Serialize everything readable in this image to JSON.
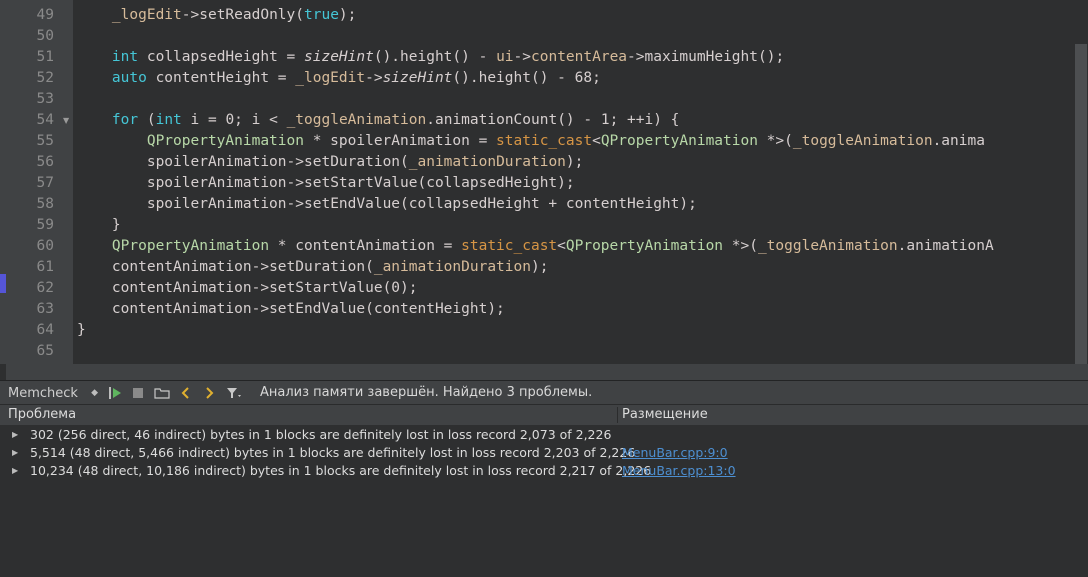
{
  "editor": {
    "lines": [
      {
        "num": "49",
        "code": [
          [
            "    ",
            ""
          ],
          [
            "_logEdit",
            "mem"
          ],
          [
            "->",
            "op"
          ],
          [
            "setReadOnly(",
            "op"
          ],
          [
            "true",
            "kw"
          ],
          [
            ");",
            "op"
          ]
        ]
      },
      {
        "num": "50",
        "code": []
      },
      {
        "num": "51",
        "code": [
          [
            "    ",
            ""
          ],
          [
            "int",
            "kw"
          ],
          [
            " collapsedHeight = ",
            "op"
          ],
          [
            "sizeHint",
            "fn"
          ],
          [
            "().height() - ",
            "op"
          ],
          [
            "ui",
            "mem"
          ],
          [
            "->",
            "op"
          ],
          [
            "contentArea",
            "mem"
          ],
          [
            "->",
            "op"
          ],
          [
            "maximumHeight();",
            "op"
          ]
        ]
      },
      {
        "num": "52",
        "code": [
          [
            "    ",
            ""
          ],
          [
            "auto",
            "kw"
          ],
          [
            " contentHeight = ",
            "op"
          ],
          [
            "_logEdit",
            "mem"
          ],
          [
            "->",
            "op"
          ],
          [
            "sizeHint",
            "fn"
          ],
          [
            "().height() - 68;",
            "op"
          ]
        ]
      },
      {
        "num": "53",
        "code": []
      },
      {
        "num": "54",
        "fold": "▼",
        "code": [
          [
            "    ",
            ""
          ],
          [
            "for",
            "kw"
          ],
          [
            " (",
            "op"
          ],
          [
            "int",
            "kw"
          ],
          [
            " i = 0; i < ",
            "op"
          ],
          [
            "_toggleAnimation",
            "mem"
          ],
          [
            ".animationCount() - 1; ++i) {",
            "op"
          ]
        ]
      },
      {
        "num": "55",
        "code": [
          [
            "        ",
            ""
          ],
          [
            "QPropertyAnimation",
            "gr"
          ],
          [
            " * spoilerAnimation = ",
            "op"
          ],
          [
            "static_cast",
            "cast"
          ],
          [
            "<",
            "op"
          ],
          [
            "QPropertyAnimation",
            "gr"
          ],
          [
            " *>(",
            "op"
          ],
          [
            "_toggleAnimation",
            "mem"
          ],
          [
            ".anima",
            "op"
          ]
        ]
      },
      {
        "num": "56",
        "code": [
          [
            "        ",
            ""
          ],
          [
            "spoilerAnimation",
            "op"
          ],
          [
            "->",
            "op"
          ],
          [
            "setDuration(",
            "op"
          ],
          [
            "_animationDuration",
            "mem"
          ],
          [
            ");",
            "op"
          ]
        ]
      },
      {
        "num": "57",
        "code": [
          [
            "        ",
            ""
          ],
          [
            "spoilerAnimation",
            "op"
          ],
          [
            "->",
            "op"
          ],
          [
            "setStartValue(collapsedHeight);",
            "op"
          ]
        ]
      },
      {
        "num": "58",
        "code": [
          [
            "        ",
            ""
          ],
          [
            "spoilerAnimation",
            "op"
          ],
          [
            "->",
            "op"
          ],
          [
            "setEndValue(collapsedHeight + contentHeight);",
            "op"
          ]
        ]
      },
      {
        "num": "59",
        "code": [
          [
            "    ",
            ""
          ],
          [
            "}",
            "op"
          ]
        ]
      },
      {
        "num": "60",
        "code": [
          [
            "    ",
            ""
          ],
          [
            "QPropertyAnimation",
            "gr"
          ],
          [
            " * contentAnimation = ",
            "op"
          ],
          [
            "static_cast",
            "cast"
          ],
          [
            "<",
            "op"
          ],
          [
            "QPropertyAnimation",
            "gr"
          ],
          [
            " *>(",
            "op"
          ],
          [
            "_toggleAnimation",
            "mem"
          ],
          [
            ".animationA",
            "op"
          ]
        ]
      },
      {
        "num": "61",
        "code": [
          [
            "    ",
            ""
          ],
          [
            "contentAnimation",
            "op"
          ],
          [
            "->",
            "op"
          ],
          [
            "setDuration(",
            "op"
          ],
          [
            "_animationDuration",
            "mem"
          ],
          [
            ");",
            "op"
          ]
        ]
      },
      {
        "num": "62",
        "code": [
          [
            "    ",
            ""
          ],
          [
            "contentAnimation",
            "op"
          ],
          [
            "->",
            "op"
          ],
          [
            "setStartValue(0);",
            "op"
          ]
        ]
      },
      {
        "num": "63",
        "code": [
          [
            "    ",
            ""
          ],
          [
            "contentAnimation",
            "op"
          ],
          [
            "->",
            "op"
          ],
          [
            "setEndValue(contentHeight);",
            "op"
          ]
        ]
      },
      {
        "num": "64",
        "code": [
          [
            "}",
            "op"
          ]
        ]
      },
      {
        "num": "65",
        "code": []
      }
    ]
  },
  "toolbar": {
    "tool_select_value": "Memcheck",
    "icons": [
      "run-icon",
      "stop-icon",
      "open-folder-icon",
      "prev-icon",
      "next-icon",
      "filter-icon"
    ],
    "status": "Анализ памяти завершён. Найдено 3 проблемы."
  },
  "table": {
    "headers": {
      "problem": "Проблема",
      "location": "Размещение"
    },
    "rows": [
      {
        "text": "302 (256 direct, 46 indirect) bytes in 1 blocks are definitely lost in loss record 2,073 of 2,226",
        "location": ""
      },
      {
        "text": "5,514 (48 direct, 5,466 indirect) bytes in 1 blocks are definitely lost in loss record 2,203 of 2,226",
        "location": "MenuBar.cpp:9:0"
      },
      {
        "text": "10,234 (48 direct, 10,186 indirect) bytes in 1 blocks are definitely lost in loss record 2,217 of 2,226",
        "location": "MenuBar.cpp:13:0"
      }
    ]
  }
}
